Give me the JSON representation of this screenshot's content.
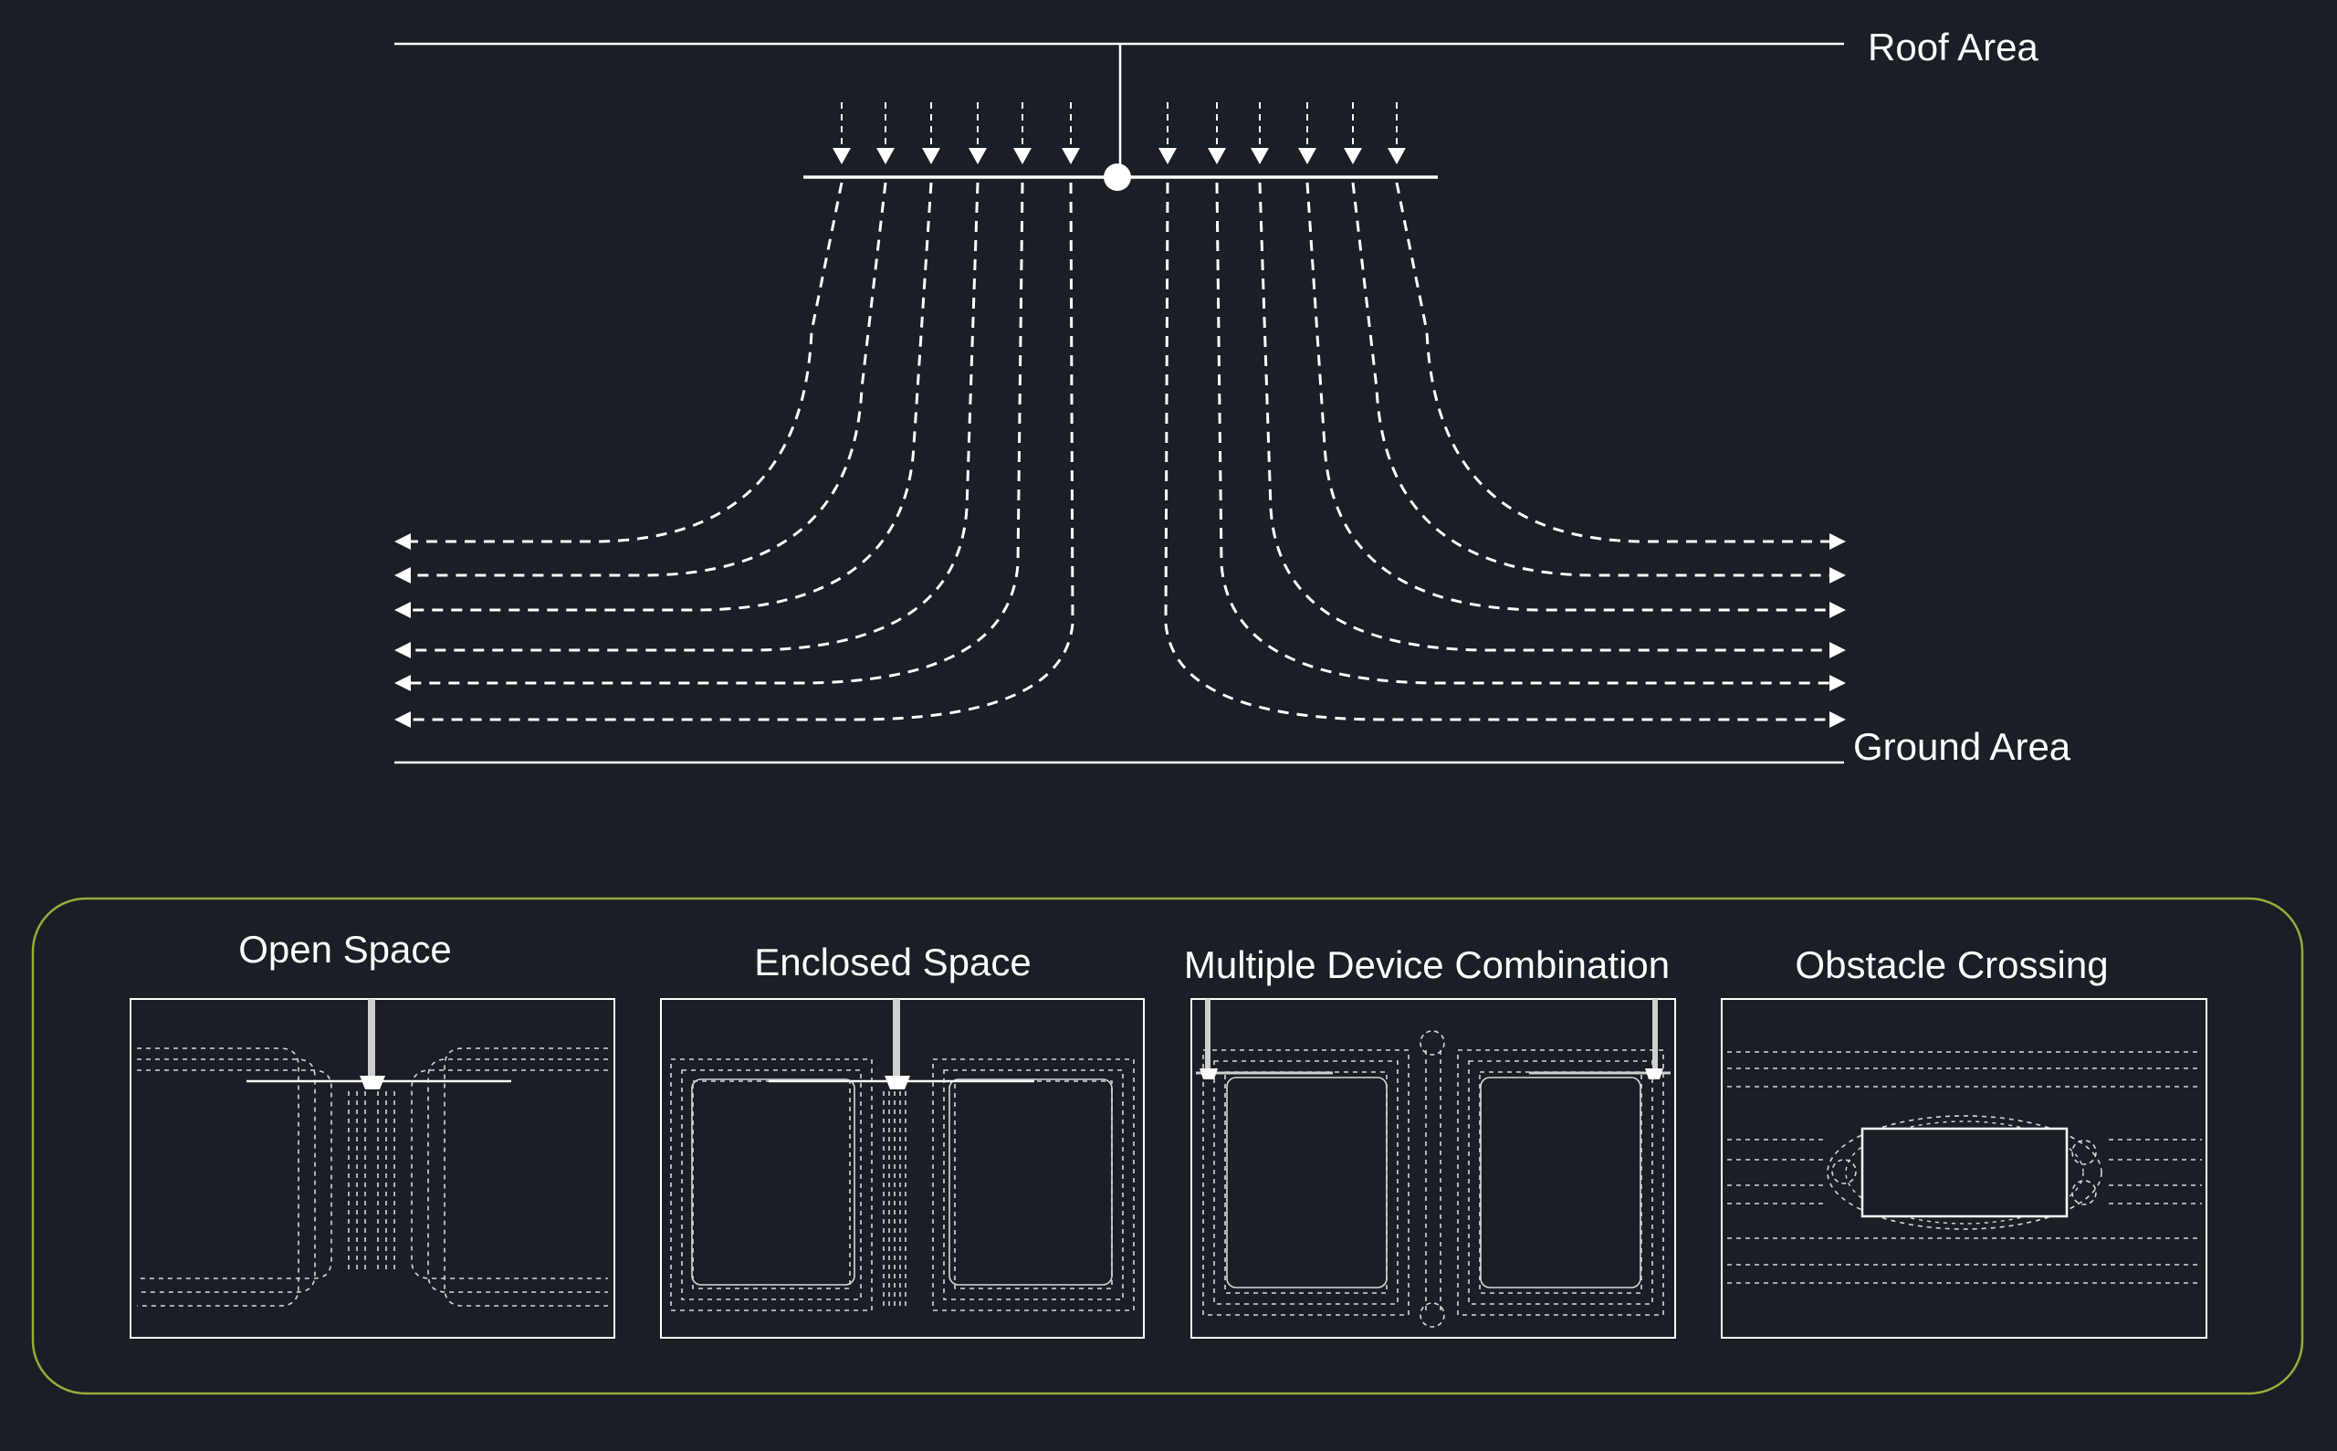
{
  "colors": {
    "background": "#1a1e25",
    "lines": "#ffffff",
    "panel_border": "#9aab3c",
    "thin_dashes": "#d8d8d8"
  },
  "main_diagram": {
    "roof_label": "Roof Area",
    "ground_label": "Ground Area",
    "inlet_arrows_per_side": 6,
    "airflow_lines_per_side": 6
  },
  "panels": [
    {
      "id": "open",
      "title": "Open Space"
    },
    {
      "id": "enclosed",
      "title": "Enclosed Space"
    },
    {
      "id": "multi",
      "title": "Multiple Device Combination"
    },
    {
      "id": "obstacle",
      "title": "Obstacle Crossing"
    }
  ]
}
